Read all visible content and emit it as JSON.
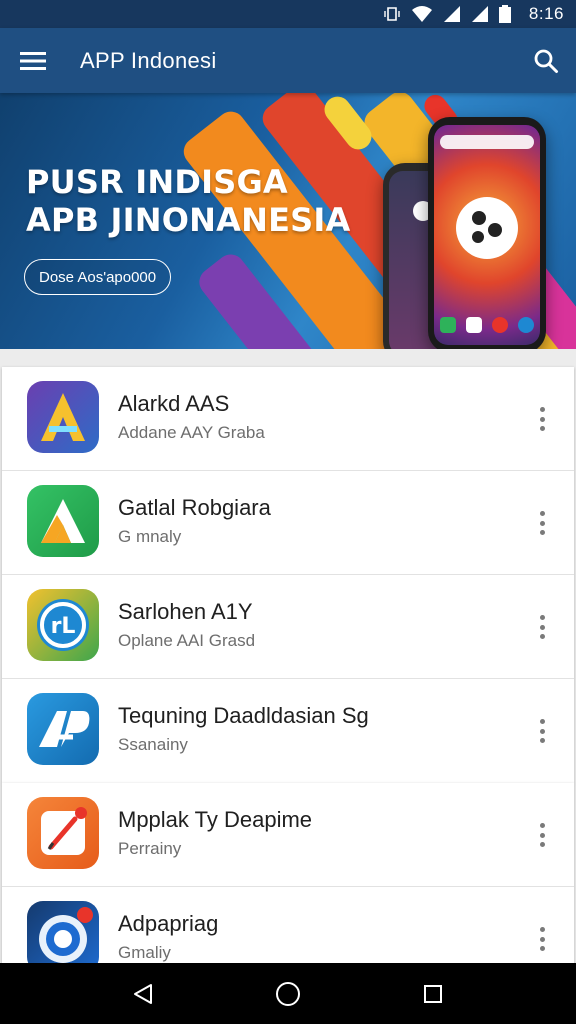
{
  "status_bar": {
    "time": "8:16",
    "icons": [
      "vibrate-icon",
      "wifi-icon",
      "signal-icon",
      "signal-icon",
      "battery-icon"
    ]
  },
  "app_bar": {
    "title": "APP Indonesi",
    "menu_icon": "hamburger-menu-icon",
    "search_icon": "search-icon"
  },
  "banner": {
    "title_line1": "PUSR INDISGA",
    "title_line2": "APB JINONANESIA",
    "button_label": "Dose Aos'apo000"
  },
  "apps_card_1": [
    {
      "title": "Alarkd AAS",
      "subtitle": "Addane AAY Graba",
      "icon": "abstract-a-app-icon",
      "colors": [
        "#5b3fa8",
        "#2e6cc7"
      ]
    },
    {
      "title": "Gatlal Robgiara",
      "subtitle": "G mnaly",
      "icon": "triangle-a-app-icon",
      "colors": [
        "#2eb25a",
        "#22a04e"
      ]
    },
    {
      "title": "Sarlohen A1Y",
      "subtitle": "Oplane AAI Grasd",
      "icon": "rl-circle-app-icon",
      "colors": [
        "#f2c12e",
        "#3ea64c"
      ]
    },
    {
      "title": "Tequning Daadldasian Sg",
      "subtitle": "Ssanainy",
      "icon": "ap-logo-app-icon",
      "colors": [
        "#1e88d2",
        "#136bb0"
      ]
    }
  ],
  "apps_card_2": [
    {
      "title": "Mpplak Ty Deapime",
      "subtitle": "Perrainy",
      "icon": "pencil-app-icon",
      "colors": [
        "#f27a2a",
        "#e65c1a"
      ]
    },
    {
      "title": "Adpapriag",
      "subtitle": "Gmaliy",
      "icon": "camera-lens-app-icon",
      "colors": [
        "#153a6e",
        "#1e6bd0"
      ]
    }
  ],
  "nav_bar": {
    "back_icon": "back-triangle-icon",
    "home_icon": "home-circle-icon",
    "recents_icon": "recents-square-icon"
  }
}
